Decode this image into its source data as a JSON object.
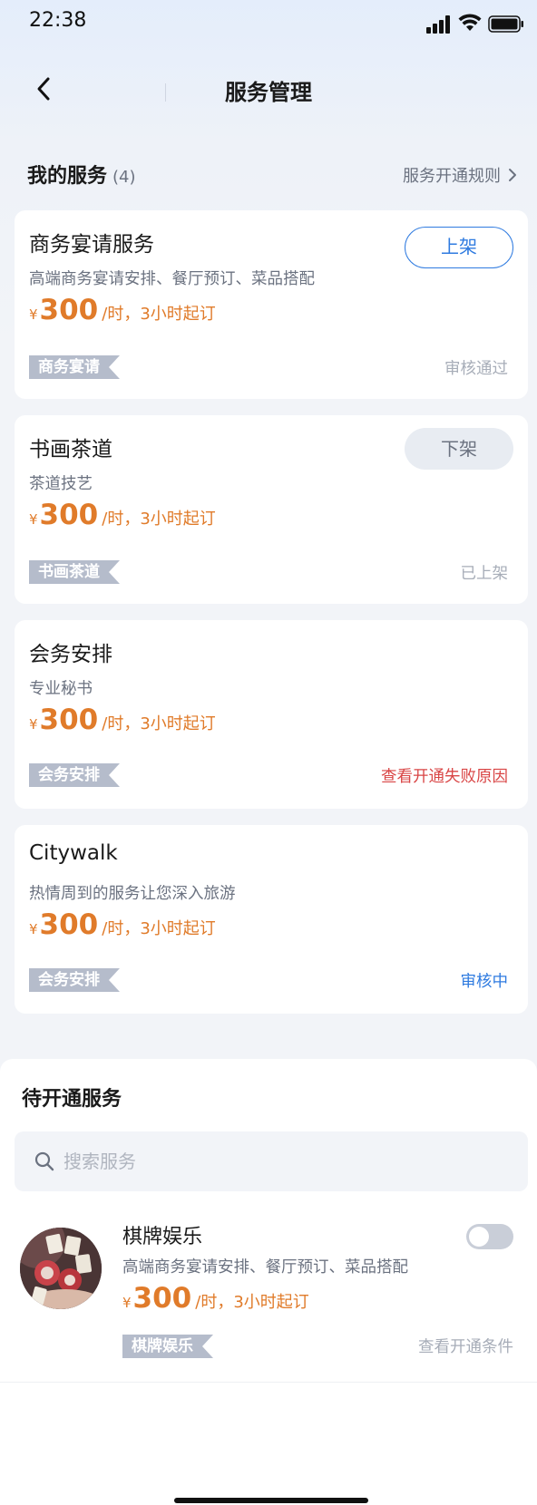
{
  "status_bar": {
    "time": "22:38"
  },
  "nav": {
    "title": "服务管理"
  },
  "my_services": {
    "title": "我的服务",
    "count": "(4)",
    "rules_link": "服务开通规则"
  },
  "cards": [
    {
      "title": "商务宴请服务",
      "desc": "高端商务宴请安排、餐厅预订、菜品搭配",
      "currency": "¥",
      "price": "300",
      "unit": "/时，3小时起订",
      "tag": "商务宴请",
      "status": "审核通过",
      "button": "上架"
    },
    {
      "title": "书画茶道",
      "desc": "茶道技艺",
      "currency": "¥",
      "price": "300",
      "unit": "/时，3小时起订",
      "tag": "书画茶道",
      "status": "已上架",
      "button": "下架"
    },
    {
      "title": "会务安排",
      "desc": "专业秘书",
      "currency": "¥",
      "price": "300",
      "unit": "/时，3小时起订",
      "tag": "会务安排",
      "status": "查看开通失败原因"
    },
    {
      "title": "Citywalk",
      "desc": "热情周到的服务让您深入旅游",
      "currency": "¥",
      "price": "300",
      "unit": "/时，3小时起订",
      "tag": "会务安排",
      "status": "审核中"
    }
  ],
  "pending": {
    "title": "待开通服务",
    "search_placeholder": "搜索服务",
    "items": [
      {
        "title": "棋牌娱乐",
        "desc": "高端商务宴请安排、餐厅预订、菜品搭配",
        "currency": "¥",
        "price": "300",
        "unit": "/时，3小时起订",
        "tag": "棋牌娱乐",
        "status": "查看开通条件",
        "enabled": false
      }
    ]
  },
  "colors": {
    "accent_blue": "#2f7be0",
    "price_orange": "#e07b2a",
    "error_red": "#d94545",
    "tag_gray": "#b5bccb"
  }
}
